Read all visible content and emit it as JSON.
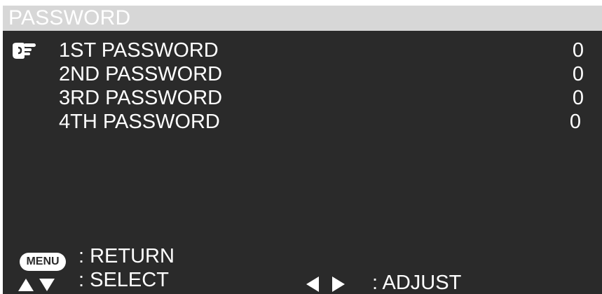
{
  "header": {
    "title": "PASSWORD"
  },
  "menu": {
    "selected_index": 0,
    "items": [
      {
        "label": "1ST PASSWORD",
        "value": "0"
      },
      {
        "label": "2ND PASSWORD",
        "value": "0"
      },
      {
        "label": "3RD PASSWORD",
        "value": "0"
      },
      {
        "label": "4TH PASSWORD",
        "value": "0"
      }
    ]
  },
  "footer": {
    "menu_button_label": "MENU",
    "return_text": ": RETURN",
    "select_text": ": SELECT",
    "adjust_text": ": ADJUST"
  },
  "icons": {
    "pointer": "pointing-hand-icon",
    "up": "triangle-up-icon",
    "down": "triangle-down-icon",
    "left": "triangle-left-icon",
    "right": "triangle-right-icon"
  },
  "colors": {
    "background": "#2a2a2a",
    "title_bar": "#d7d7d7",
    "text": "#ffffff"
  }
}
